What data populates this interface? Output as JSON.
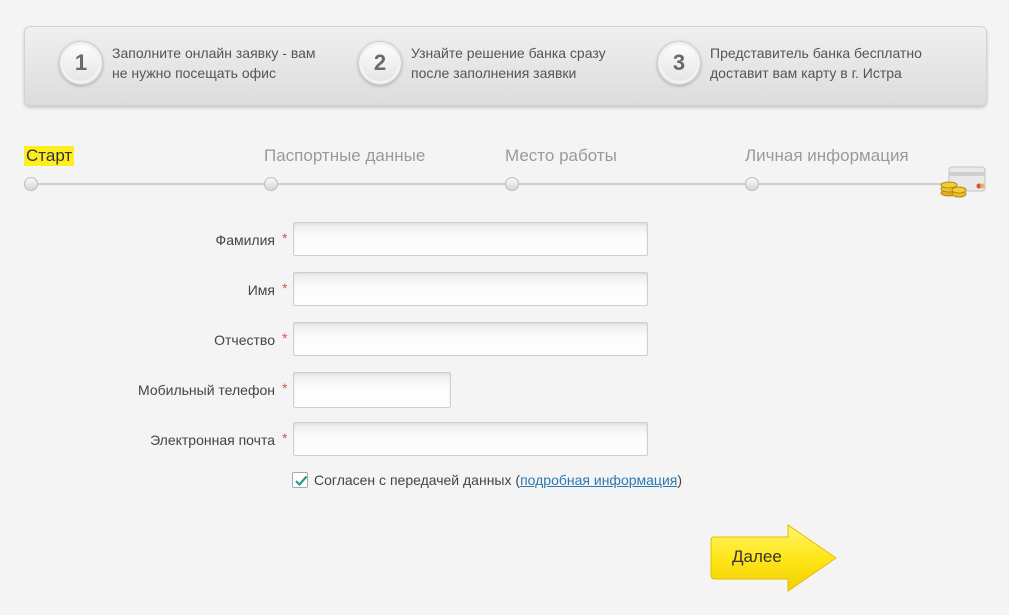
{
  "banner": {
    "steps": [
      {
        "num": "1",
        "text": "Заполните онлайн заявку - вам\nне нужно посещать офис"
      },
      {
        "num": "2",
        "text": "Узнайте решение банка сразу\nпосле заполнения заявки"
      },
      {
        "num": "3",
        "text": "Представитель банка бесплатно\nдоставит вам карту в г. Истра"
      }
    ]
  },
  "progress": {
    "stages": [
      "Старт",
      "Паспортные данные",
      "Место работы",
      "Личная информация"
    ],
    "active": "Старт"
  },
  "form": {
    "fields": [
      {
        "label": "Фамилия",
        "value": "",
        "required": "*"
      },
      {
        "label": "Имя",
        "value": "",
        "required": "*"
      },
      {
        "label": "Отчество",
        "value": "",
        "required": "*"
      },
      {
        "label": "Мобильный телефон",
        "value": "",
        "required": "*"
      },
      {
        "label": "Электронная почта",
        "value": "",
        "required": "*"
      }
    ],
    "consent": {
      "checked": true,
      "text_before": "Согласен с передачей данных (",
      "link": "подробная информация",
      "text_after": ")"
    }
  },
  "next_button": {
    "label": "Далее"
  },
  "colors": {
    "accent_yellow": "#ffee1f",
    "link": "#2a7ab0",
    "required": "#d9534f"
  }
}
